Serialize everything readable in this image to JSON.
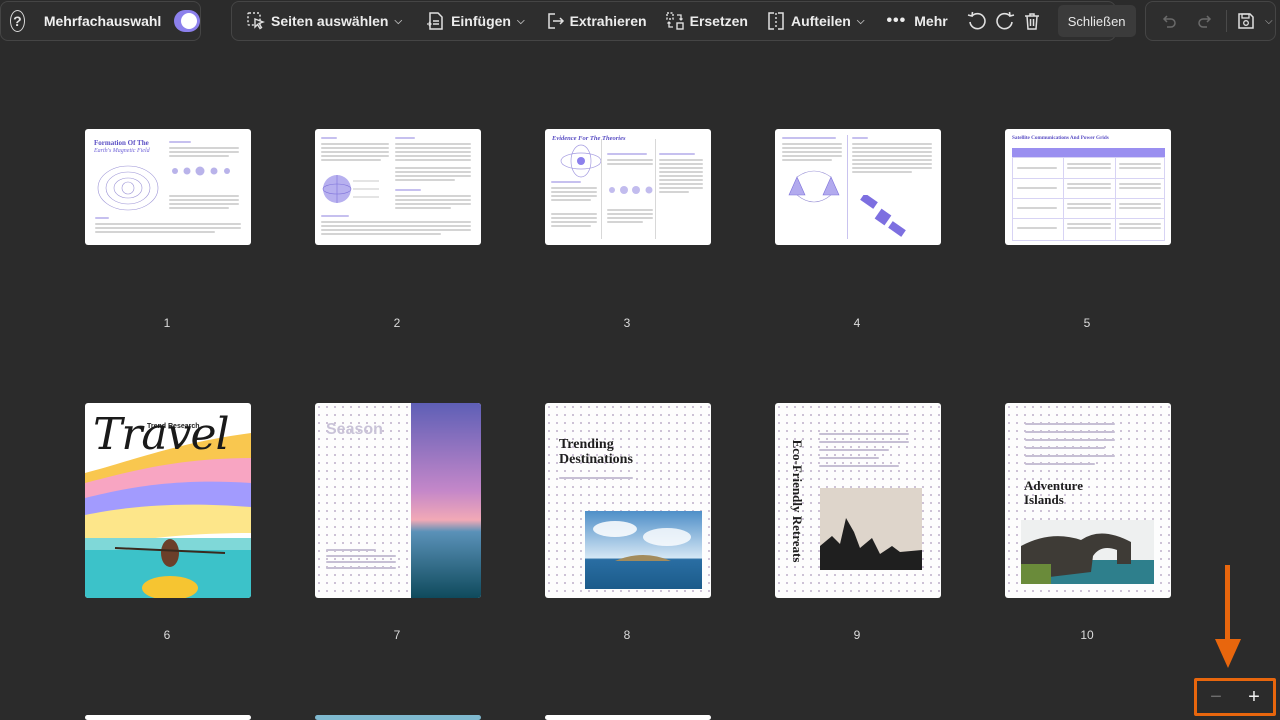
{
  "header": {
    "help_icon": "question-circle-icon",
    "multi_select_label": "Mehrfachauswahl",
    "multi_select_on": true,
    "accent": "#8c80ec"
  },
  "toolbar": {
    "select_pages": "Seiten auswählen",
    "insert": "Einfügen",
    "extract": "Extrahieren",
    "replace": "Ersetzen",
    "split": "Aufteilen",
    "more": "Mehr",
    "close": "Schließen"
  },
  "pages": [
    {
      "number": "1",
      "title": "Formation Of The",
      "subtitle": "Earth's Magnetic Field"
    },
    {
      "number": "2"
    },
    {
      "number": "3",
      "title": "Evidence For The Theories"
    },
    {
      "number": "4"
    },
    {
      "number": "5",
      "title": "Satellite Communications And Power Grids"
    },
    {
      "number": "6",
      "title": "Travel",
      "subtitle": "Trend Research"
    },
    {
      "number": "7",
      "title": "Season"
    },
    {
      "number": "8",
      "title": "Trending Destinations"
    },
    {
      "number": "9",
      "title": "Eco-Friendly Retreats"
    },
    {
      "number": "10",
      "title": "Adventure Islands"
    }
  ],
  "zoom": {
    "out_icon": "minus-icon",
    "in_icon": "plus-icon",
    "highlight_color": "#e8660d"
  }
}
